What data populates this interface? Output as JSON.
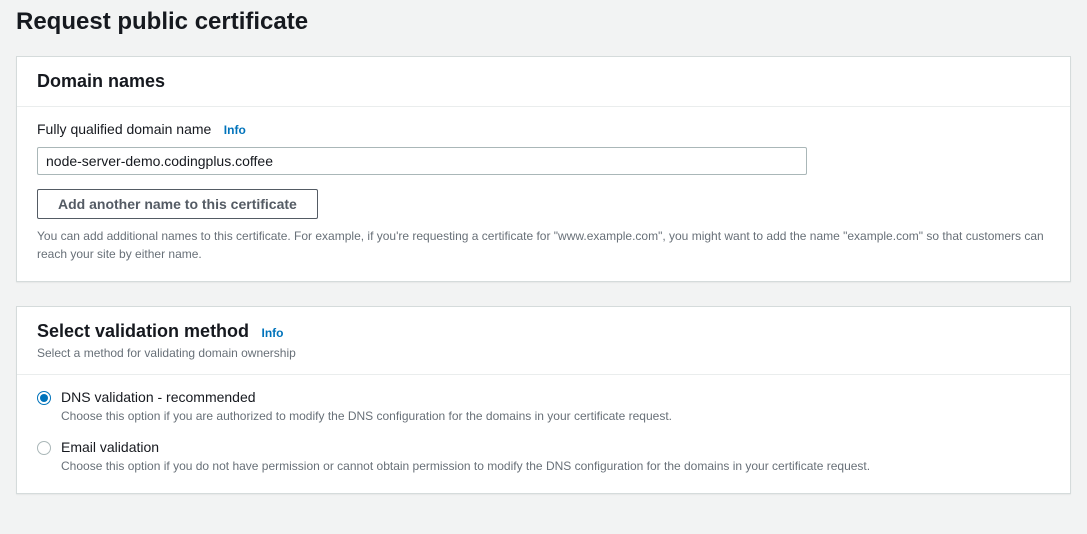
{
  "page": {
    "title": "Request public certificate"
  },
  "domain_names": {
    "heading": "Domain names",
    "fqdn_label": "Fully qualified domain name",
    "fqdn_info": "Info",
    "fqdn_value": "node-server-demo.codingplus.coffee",
    "add_button": "Add another name to this certificate",
    "help_text": "You can add additional names to this certificate. For example, if you're requesting a certificate for \"www.example.com\", you might want to add the name \"example.com\" so that customers can reach your site by either name."
  },
  "validation": {
    "heading": "Select validation method",
    "info": "Info",
    "desc": "Select a method for validating domain ownership",
    "options": [
      {
        "label": "DNS validation - recommended",
        "desc": "Choose this option if you are authorized to modify the DNS configuration for the domains in your certificate request.",
        "selected": true
      },
      {
        "label": "Email validation",
        "desc": "Choose this option if you do not have permission or cannot obtain permission to modify the DNS configuration for the domains in your certificate request.",
        "selected": false
      }
    ]
  }
}
